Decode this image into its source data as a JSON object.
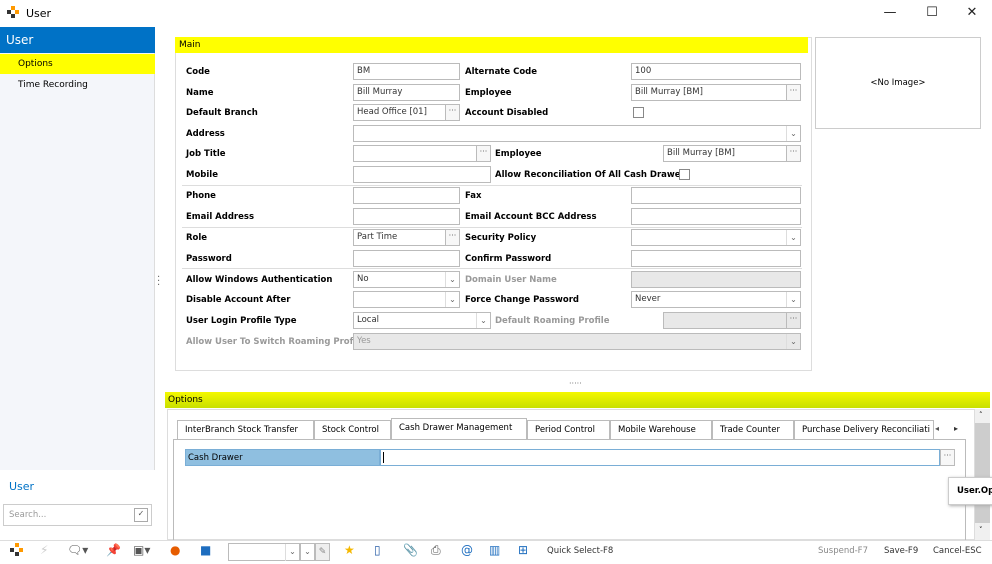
{
  "window": {
    "title": "User",
    "minimize": "—",
    "maximize": "☐",
    "close": "✕"
  },
  "sidebar": {
    "header": "User",
    "items": [
      {
        "label": "Options",
        "selected": true
      },
      {
        "label": "Time Recording"
      }
    ],
    "footer_title": "User",
    "search_placeholder": "Search..."
  },
  "main": {
    "title": "Main",
    "image_placeholder": "<No Image>",
    "fields": {
      "code": {
        "label": "Code",
        "value": "BM"
      },
      "alternate_code": {
        "label": "Alternate Code",
        "value": "100"
      },
      "name": {
        "label": "Name",
        "value": "Bill Murray"
      },
      "employee": {
        "label": "Employee",
        "value": "Bill Murray [BM]"
      },
      "default_branch": {
        "label": "Default Branch",
        "value": "Head Office [01]"
      },
      "account_disabled": {
        "label": "Account Disabled",
        "checked": false
      },
      "address": {
        "label": "Address",
        "value": ""
      },
      "job_title": {
        "label": "Job Title",
        "value": ""
      },
      "employee2": {
        "label": "Employee",
        "value": "Bill Murray [BM]"
      },
      "mobile": {
        "label": "Mobile",
        "value": ""
      },
      "allow_reconciliation": {
        "label": "Allow Reconciliation Of All Cash Drawers",
        "checked": false
      },
      "phone": {
        "label": "Phone",
        "value": ""
      },
      "fax": {
        "label": "Fax",
        "value": ""
      },
      "email": {
        "label": "Email Address",
        "value": ""
      },
      "email_bcc": {
        "label": "Email Account BCC Address",
        "value": ""
      },
      "role": {
        "label": "Role",
        "value": "Part Time"
      },
      "security_policy": {
        "label": "Security Policy",
        "value": ""
      },
      "password": {
        "label": "Password",
        "value": ""
      },
      "confirm_password": {
        "label": "Confirm Password",
        "value": ""
      },
      "allow_windows_auth": {
        "label": "Allow Windows Authentication",
        "value": "No"
      },
      "domain_user_name": {
        "label": "Domain User Name",
        "value": ""
      },
      "disable_account_after": {
        "label": "Disable Account After",
        "value": ""
      },
      "force_change_password": {
        "label": "Force Change Password",
        "value": "Never"
      },
      "user_login_profile_type": {
        "label": "User Login Profile Type",
        "value": "Local"
      },
      "default_roaming_profile": {
        "label": "Default Roaming Profile",
        "value": ""
      },
      "allow_switch_roaming": {
        "label": "Allow User To Switch Roaming Profile",
        "value": "Yes"
      }
    }
  },
  "options": {
    "title": "Options",
    "tabs": [
      "InterBranch Stock Transfer",
      "Stock Control",
      "Cash Drawer Management",
      "Period Control",
      "Mobile Warehouse",
      "Trade Counter",
      "Purchase Delivery Reconciliati"
    ],
    "active_tab": 2,
    "cash_drawer": {
      "label": "Cash Drawer",
      "value": ""
    },
    "tooltip": "User.Opt"
  },
  "toolbar": {
    "quick_select": "Quick Select-F8",
    "suspend": "Suspend-F7",
    "save": "Save-F9",
    "cancel": "Cancel-ESC",
    "combo_value": ""
  },
  "colors": {
    "accent_blue": "#0072c6",
    "highlight_yellow": "#ffff00",
    "selected_row": "#8fbfe0"
  }
}
